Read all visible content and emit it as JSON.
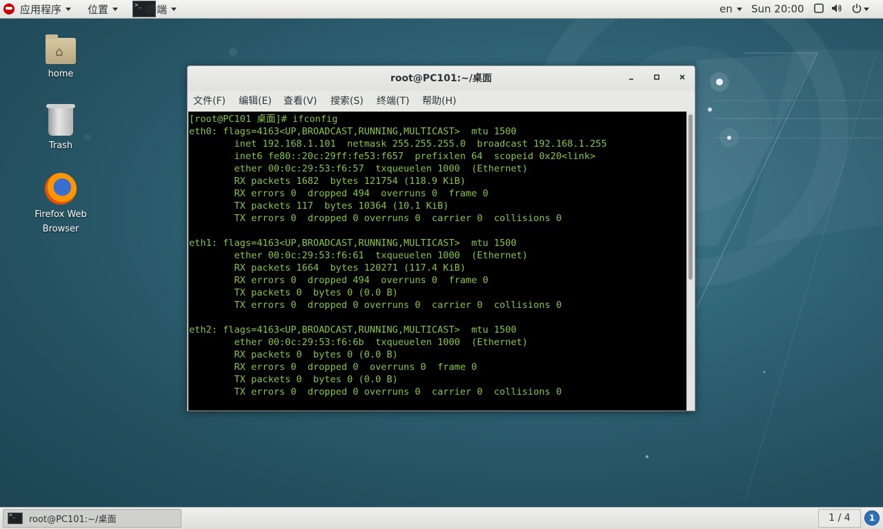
{
  "topbar": {
    "applications_label": "应用程序",
    "places_label": "位置",
    "active_app_label": "终端",
    "keyboard_layout": "en",
    "clock": "Sun 20:00"
  },
  "desktop": {
    "icons": [
      {
        "label": "home",
        "icon": "home-folder-icon"
      },
      {
        "label": "Trash",
        "icon": "trash-icon"
      },
      {
        "label": "Firefox Web Browser",
        "icon": "firefox-icon"
      }
    ]
  },
  "terminal": {
    "title": "root@PC101:~/桌面",
    "menu": [
      "文件(F)",
      "编辑(E)",
      "查看(V)",
      "搜索(S)",
      "终端(T)",
      "帮助(H)"
    ],
    "lines": [
      "[root@PC101 桌面]# ifconfig",
      "eth0: flags=4163<UP,BROADCAST,RUNNING,MULTICAST>  mtu 1500",
      "        inet 192.168.1.101  netmask 255.255.255.0  broadcast 192.168.1.255",
      "        inet6 fe80::20c:29ff:fe53:f657  prefixlen 64  scopeid 0x20<link>",
      "        ether 00:0c:29:53:f6:57  txqueuelen 1000  (Ethernet)",
      "        RX packets 1682  bytes 121754 (118.9 KiB)",
      "        RX errors 0  dropped 494  overruns 0  frame 0",
      "        TX packets 117  bytes 10364 (10.1 KiB)",
      "        TX errors 0  dropped 0 overruns 0  carrier 0  collisions 0",
      "",
      "eth1: flags=4163<UP,BROADCAST,RUNNING,MULTICAST>  mtu 1500",
      "        ether 00:0c:29:53:f6:61  txqueuelen 1000  (Ethernet)",
      "        RX packets 1664  bytes 120271 (117.4 KiB)",
      "        RX errors 0  dropped 494  overruns 0  frame 0",
      "        TX packets 0  bytes 0 (0.0 B)",
      "        TX errors 0  dropped 0 overruns 0  carrier 0  collisions 0",
      "",
      "eth2: flags=4163<UP,BROADCAST,RUNNING,MULTICAST>  mtu 1500",
      "        ether 00:0c:29:53:f6:6b  txqueuelen 1000  (Ethernet)",
      "        RX packets 0  bytes 0 (0.0 B)",
      "        RX errors 0  dropped 0  overruns 0  frame 0",
      "        TX packets 0  bytes 0 (0.0 B)",
      "        TX errors 0  dropped 0 overruns 0  carrier 0  collisions 0"
    ]
  },
  "taskbar": {
    "window_label": "root@PC101:~/桌面",
    "workspace": "1 / 4",
    "notification_count": "1"
  },
  "colors": {
    "terminal_text": "#86c540",
    "terminal_bg": "#000000",
    "desktop_bg": "#2f6577"
  }
}
